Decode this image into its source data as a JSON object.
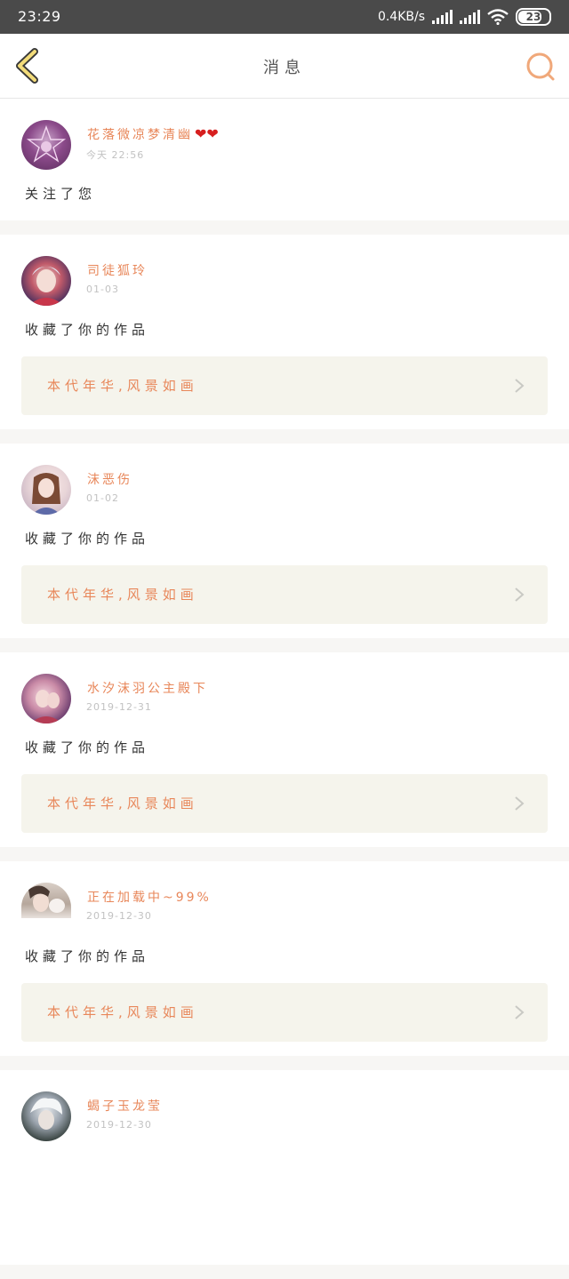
{
  "status_bar": {
    "time": "23:29",
    "net_speed": "0.4KB/s",
    "battery": "23"
  },
  "header": {
    "title": "消息",
    "accent": "#e8875a",
    "back_icon": "back-chevron-icon",
    "search_icon": "search-icon"
  },
  "messages": [
    {
      "user": "花落微凉梦清幽",
      "suffix": "❤❤",
      "time": "今天 22:56",
      "action": "关注了您",
      "work": ""
    },
    {
      "user": "司徒狐玲",
      "suffix": "",
      "time": "01-03",
      "action": "收藏了你的作品",
      "work": "本代年华,风景如画"
    },
    {
      "user": "沫恶伤",
      "suffix": "",
      "time": "01-02",
      "action": "收藏了你的作品",
      "work": "本代年华,风景如画"
    },
    {
      "user": "水汐沫羽公主殿下",
      "suffix": "",
      "time": "2019-12-31",
      "action": "收藏了你的作品",
      "work": "本代年华,风景如画"
    },
    {
      "user": "正在加载中~99%",
      "suffix": "",
      "time": "2019-12-30",
      "action": "收藏了你的作品",
      "work": "本代年华,风景如画"
    },
    {
      "user": "蝎子玉龙莹",
      "suffix": "",
      "time": "2019-12-30",
      "action": "",
      "work": ""
    }
  ]
}
